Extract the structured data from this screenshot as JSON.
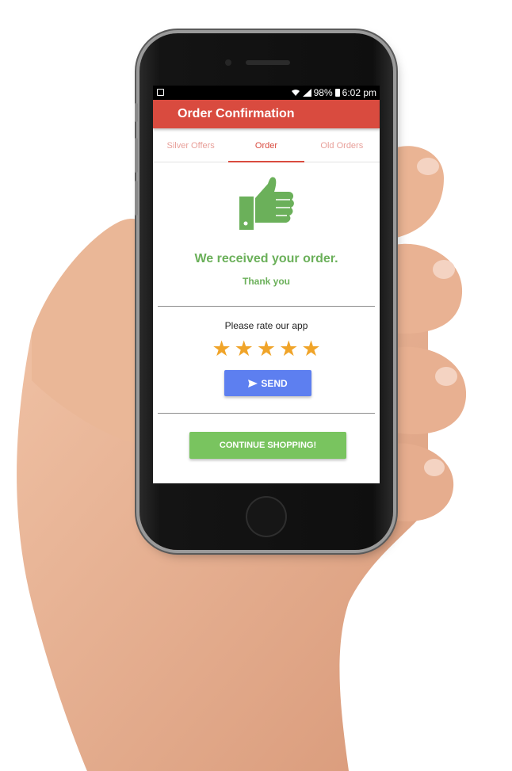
{
  "status_bar": {
    "battery": "98%",
    "time": "6:02 pm",
    "icons": [
      "screenshot-icon",
      "wifi-icon",
      "signal-icon",
      "battery-icon"
    ]
  },
  "appbar": {
    "title": "Order Confirmation"
  },
  "tabs": [
    {
      "label": "Silver Offers",
      "active": false
    },
    {
      "label": "Order",
      "active": true
    },
    {
      "label": "Old Orders",
      "active": false
    }
  ],
  "confirmation": {
    "icon": "thumbs-up-icon",
    "message": "We received your order.",
    "thanks": "Thank you"
  },
  "rating": {
    "label": "Please rate our app",
    "stars": 5,
    "max_stars": 5,
    "send_label": "SEND",
    "send_icon": "send-icon"
  },
  "actions": {
    "continue_label": "CONTINUE SHOPPING!"
  },
  "colors": {
    "primary": "#d94b3f",
    "success": "#6bb05a",
    "send": "#5d7ff0",
    "continue": "#79c45f",
    "star": "#f0a429"
  }
}
